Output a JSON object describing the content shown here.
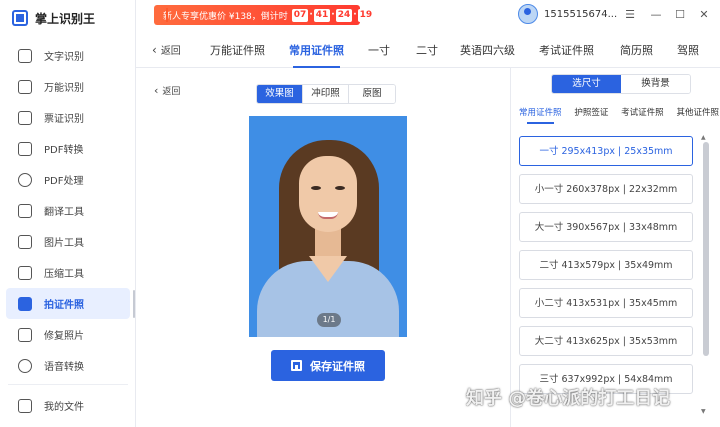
{
  "app": {
    "name": "掌上识别王"
  },
  "sidebar": {
    "items": [
      {
        "label": "文字识别",
        "icon": "text-scan-icon"
      },
      {
        "label": "万能识别",
        "icon": "universal-scan-icon"
      },
      {
        "label": "票证识别",
        "icon": "receipt-scan-icon"
      },
      {
        "label": "PDF转换",
        "icon": "pdf-convert-icon"
      },
      {
        "label": "PDF处理",
        "icon": "pdf-process-icon"
      },
      {
        "label": "翻译工具",
        "icon": "translate-icon"
      },
      {
        "label": "图片工具",
        "icon": "image-tool-icon"
      },
      {
        "label": "压缩工具",
        "icon": "compress-icon"
      },
      {
        "label": "拍证件照",
        "icon": "id-photo-icon",
        "active": true
      },
      {
        "label": "修复照片",
        "icon": "photo-repair-icon"
      },
      {
        "label": "语音转换",
        "icon": "voice-convert-icon"
      }
    ],
    "bottom": {
      "label": "我的文件",
      "icon": "my-files-icon"
    }
  },
  "topbar": {
    "promo_text": "新人专享优惠价 ¥138，倒计时",
    "countdown": [
      "07",
      "41",
      "24",
      "19"
    ],
    "phone": "1515515674...",
    "controls": [
      "menu-icon",
      "minimize-icon",
      "maximize-icon",
      "close-icon"
    ]
  },
  "tabs": {
    "back_label": "返回",
    "items": [
      "万能证件照",
      "常用证件照",
      "一寸",
      "二寸",
      "英语四六级",
      "考试证件照",
      "简历照",
      "驾照"
    ],
    "active_index": 1
  },
  "preview": {
    "back_label": "返回",
    "segments": [
      "效果图",
      "冲印照",
      "原图"
    ],
    "active_segment": 0,
    "page_indicator": "1/1",
    "photo_bg_color": "#3f8ee5",
    "save_label": "保存证件照"
  },
  "right_panel": {
    "segments": [
      "选尺寸",
      "换背景"
    ],
    "active_segment": 0,
    "subtabs": [
      "常用证件照",
      "护照签证",
      "考试证件照",
      "其他证件照"
    ],
    "active_subtab": 0,
    "sizes": [
      "一寸 295x413px | 25x35mm",
      "小一寸 260x378px | 22x32mm",
      "大一寸 390x567px | 33x48mm",
      "二寸 413x579px | 35x49mm",
      "小二寸 413x531px | 35x45mm",
      "大二寸 413x625px | 35x53mm",
      "三寸 637x992px | 54x84mm"
    ],
    "active_size": 0
  },
  "watermark": "知乎 @卷心派的打工日记",
  "colors": {
    "accent": "#2b63e0",
    "promo": "#ff3b30"
  }
}
